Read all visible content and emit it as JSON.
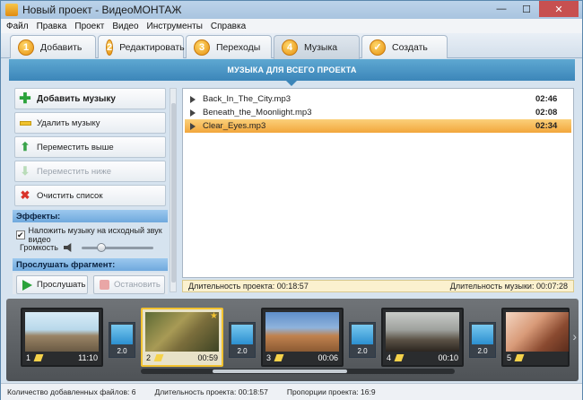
{
  "window": {
    "title": "Новый проект - ВидеоМОНТАЖ",
    "minimize": "—",
    "maximize": "☐",
    "close": "✕"
  },
  "menu": [
    "Файл",
    "Правка",
    "Проект",
    "Видео",
    "Инструменты",
    "Справка"
  ],
  "tabs": [
    {
      "num": "1",
      "label": "Добавить"
    },
    {
      "num": "2",
      "label": "Редактировать"
    },
    {
      "num": "3",
      "label": "Переходы"
    },
    {
      "num": "4",
      "label": "Музыка",
      "active": true
    },
    {
      "num": "✓",
      "label": "Создать"
    }
  ],
  "banner": "МУЗЫКА ДЛЯ ВСЕГО ПРОЕКТА",
  "actions": {
    "add": "Добавить музыку",
    "delete": "Удалить музыку",
    "up": "Переместить выше",
    "down": "Переместить ниже",
    "clear": "Очистить список"
  },
  "effects": {
    "header": "Эффекты:",
    "overlay_label": "Наложить музыку на исходный звук видео",
    "overlay_checked": true,
    "volume_label": "Громкость",
    "volume_level": 0.25
  },
  "preview": {
    "header": "Прослушать фрагмент:",
    "play": "Прослушать",
    "stop": "Остановить"
  },
  "tracks": [
    {
      "name": "Back_In_The_City.mp3",
      "duration": "02:46",
      "selected": false
    },
    {
      "name": "Beneath_the_Moonlight.mp3",
      "duration": "02:08",
      "selected": false
    },
    {
      "name": "Clear_Eyes.mp3",
      "duration": "02:34",
      "selected": true
    }
  ],
  "status": {
    "project": "Длительность проекта: 00:18:57",
    "music": "Длительность музыки: 00:07:28"
  },
  "clips": [
    {
      "num": "1",
      "duration": "11:10"
    },
    {
      "num": "2",
      "duration": "00:59"
    },
    {
      "num": "3",
      "duration": "00:06"
    },
    {
      "num": "4",
      "duration": "00:10"
    },
    {
      "num": "5",
      "duration": "00:59"
    }
  ],
  "transitions": [
    "2.0",
    "2.0",
    "2.0",
    "2.0"
  ],
  "footer": {
    "files": "Количество добавленных файлов: 6",
    "duration": "Длительность проекта: 00:18:57",
    "ratio": "Пропорции проекта: 16:9"
  }
}
